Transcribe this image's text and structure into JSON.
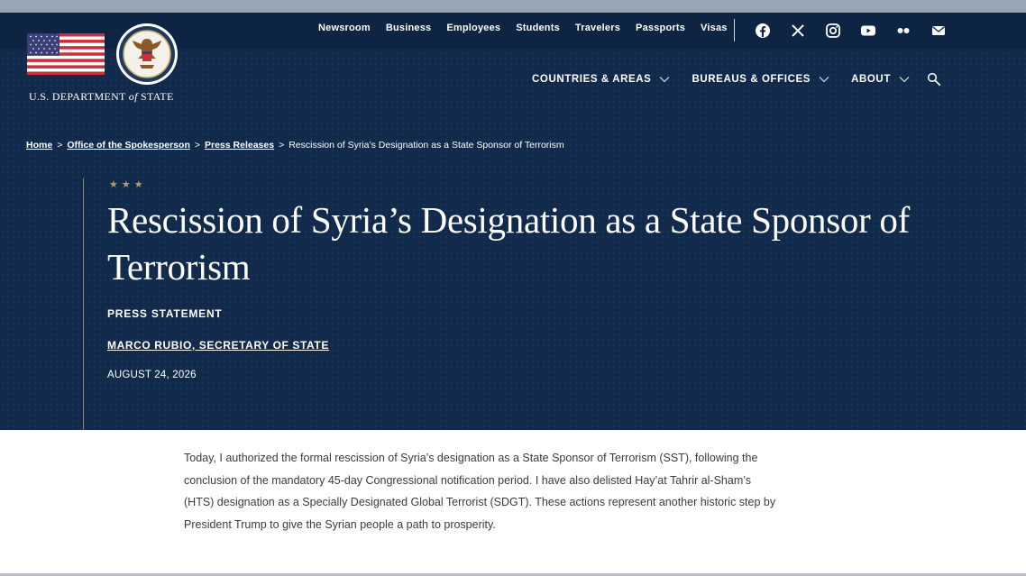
{
  "header": {
    "department_prefix": "U.S. DEPARTMENT",
    "department_of": "of",
    "department_suffix": "STATE",
    "utility_links": [
      "Newsroom",
      "Business",
      "Employees",
      "Students",
      "Travelers",
      "Passports",
      "Visas"
    ],
    "social_icons": [
      "facebook-icon",
      "x-icon",
      "instagram-icon",
      "youtube-icon",
      "flickr-icon",
      "email-icon"
    ],
    "nav": [
      "COUNTRIES & AREAS",
      "BUREAUS & OFFICES",
      "ABOUT"
    ]
  },
  "breadcrumb": {
    "items": [
      "Home",
      "Office of the Spokesperson",
      "Press Releases"
    ],
    "current": "Rescission of Syria’s Designation as a State Sponsor of Terrorism",
    "separator": ">"
  },
  "article": {
    "stars": "★★★",
    "title": "Rescission of Syria’s Designation as a State Sponsor of Terrorism",
    "type": "PRESS STATEMENT",
    "author": "MARCO RUBIO, SECRETARY OF STATE",
    "date": "AUGUST 24, 2026",
    "body": "Today, I authorized the formal rescission of Syria’s designation as a State Sponsor of Terrorism (SST), following the conclusion of the mandatory 45-day Congressional notification period.   I have also delisted Hay’at Tahrir al-Sham’s (HTS) designation as a Specially Designated Global Terrorist (SDGT). These actions represent another historic step by President Trump to give the Syrian people a path to prosperity."
  },
  "colors": {
    "hero_background": "#112a4b",
    "utility_bar": "#0d2442",
    "accent_gold": "#b39a72",
    "body_text": "#3b3b3b"
  }
}
